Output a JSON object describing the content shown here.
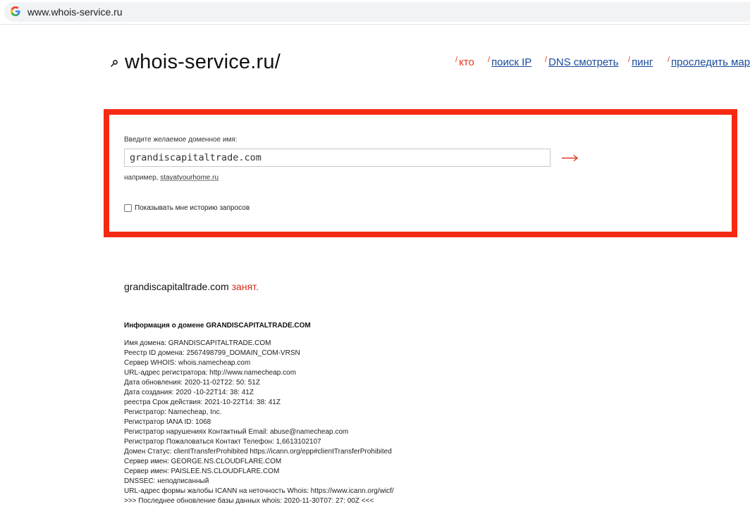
{
  "browser": {
    "url": "www.whois-service.ru",
    "icon": "google-g-icon"
  },
  "header": {
    "logo_icon": "search-key-icon",
    "logo_text": "whois-service.ru/",
    "nav": [
      {
        "label": "кто",
        "active": true
      },
      {
        "label": "поиск IP",
        "active": false
      },
      {
        "label": "DNS смотреть",
        "active": false
      },
      {
        "label": "пинг",
        "active": false
      },
      {
        "label": "проследить маршрут",
        "active": false
      }
    ]
  },
  "search": {
    "label": "Введите желаемое доменное имя:",
    "value": "grandiscapitaltrade.com",
    "submit_icon": "arrow-right-icon",
    "example_prefix": "например,",
    "example_link": "stayatyourhome.ru",
    "history_label": "Показывать мне историю запросов",
    "history_checked": false
  },
  "result": {
    "domain": "grandiscapitaltrade.com",
    "status": "занят."
  },
  "info": {
    "heading": "Информация о домене GRANDISCAPITALTRADE.COM",
    "lines": [
      "Имя домена: GRANDISCAPITALTRADE.COM",
      "Реестр ID домена: 2567498799_DOMAIN_COM-VRSN",
      "Сервер WHOIS: whois.namecheap.com",
      "URL-адрес регистратора: http://www.namecheap.com",
      "Дата обновления: 2020-11-02T22: 50: 51Z",
      "Дата создания: 2020 -10-22T14: 38: 41Z",
      "реестра Срок действия: 2021-10-22T14: 38: 41Z",
      "Регистратор: Namecheap, Inc.",
      "Регистратор IANA ID: 1068",
      "Регистратор нарушениях Контактный Email: abuse@namecheap.com",
      "Регистратор Пожаловаться Контакт Телефон: 1,6613102107",
      "Домен Статус: clientTransferProhibited https://icann.org/epp#clientTransferProhibited",
      "Сервер имен: GEORGE.NS.CLOUDFLARE.COM",
      "Сервер имен: PAISLEE.NS.CLOUDFLARE.COM",
      "DNSSEC: неподписанный",
      "URL-адрес формы жалобы ICANN на неточность Whois: https://www.icann.org/wicf/",
      ">>> Последнее обновление базы данных whois: 2020-11-30T07: 27: 00Z <<<"
    ]
  },
  "colors": {
    "accent_red": "#f52a12",
    "link_blue": "#1a4b9b",
    "status_red": "#d42e1c"
  }
}
